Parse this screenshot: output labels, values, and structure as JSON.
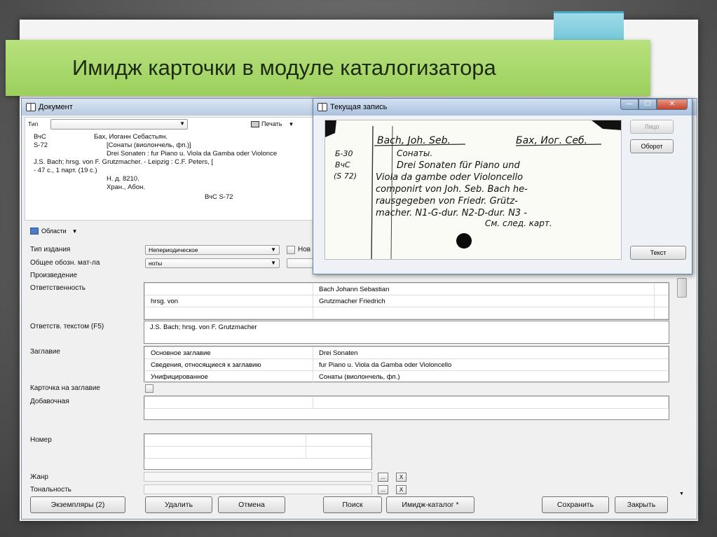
{
  "slide": {
    "title": "Имидж карточки в модуле каталогизатора"
  },
  "doc_window": {
    "title": "Документ",
    "tip_label": "Тип",
    "print_label": "Печать",
    "card_preview": {
      "line1_left": "ВчС",
      "line1_right": "Бах, Иоганн Себастьян.",
      "line2_left": "S-72",
      "line2_right": "[Сонаты (виолончель, фп.)]",
      "line3": "Drei Sonaten : fur Piano u. Viola da Gamba oder Violonce",
      "line4": "J.S. Bach; hrsg. von F. Grutzmacher. - Leipzig : C.F. Peters, [",
      "line5": "- 47 c., 1 парт. (19 с.)",
      "line6": "Н. д. 8210.",
      "line7": "Хран., Абон.",
      "line8": "ВчС S-72"
    },
    "oblasti_label": "Области",
    "fields": {
      "tip_izdaniya": {
        "label": "Тип издания",
        "value": "Непериодическое",
        "new_label": "Нов"
      },
      "obshchee_oboz": {
        "label": "Общее обозн. мат-ла",
        "value": "ноты"
      },
      "proizvedenie": {
        "label": "Произведение"
      },
      "otvetstvennost": {
        "label": "Ответственность",
        "rows": [
          [
            "",
            "Bach Johann Sebastian"
          ],
          [
            "hrsg. von",
            "Grutzmacher Friedrich"
          ],
          [
            "",
            ""
          ]
        ]
      },
      "otvetstv_tekstom": {
        "label": "Ответств. текстом (F5)",
        "value": "J.S. Bach; hrsg. von F. Grutzmacher"
      },
      "zaglavie": {
        "label": "Заглавие",
        "rows": [
          [
            "Основное заглавие",
            "Drei Sonaten"
          ],
          [
            "Сведения, относящиеся к заглавию",
            "fur Piano u. Viola da Gamba oder Violoncello"
          ],
          [
            "Унифицированное",
            "Сонаты (виолончель, фп.)"
          ]
        ]
      },
      "kartochka": {
        "label": "Карточка на заглавие"
      },
      "dobavochnaya": {
        "label": "Добавочная"
      },
      "nomer": {
        "label": "Номер"
      },
      "zhanr": {
        "label": "Жанр"
      },
      "tonalnost": {
        "label": "Тональность"
      }
    },
    "mini_buttons": {
      "ellipsis": "...",
      "clear": "X"
    },
    "buttons": {
      "ekzemplyary": "Экземпляры (2)",
      "udalit": "Удалить",
      "otmena": "Отмена",
      "poisk": "Поиск",
      "imidzh": "Имидж-каталог  *",
      "sokhranit": "Сохранить",
      "zakryt": "Закрыть"
    }
  },
  "record_window": {
    "title": "Текущая запись",
    "buttons": {
      "litso": "Лицо",
      "oborot": "Оборот",
      "tekst": "Текст"
    },
    "card_text": {
      "h_left": "Bach, Joh. Seb.",
      "h_right": "Бах, Иог. Себ.",
      "shelf1": "Б-30",
      "shelf2": "ВчС",
      "shelf3": "(S 72)",
      "t1": "Сонаты.",
      "t2": "Drei Sonaten für Piano und",
      "t3": "Viola da gambe oder Violoncello",
      "t4": "componirt von Joh. Seb. Bach he-",
      "t5": "rausgegeben von Friedr. Grütz-",
      "t6": "macher. N1-G-dur. N2-D-dur. N3 -",
      "t7": "См. след. карт."
    }
  },
  "colors": {
    "title_band": "#a8d86a",
    "accent_cyan": "#7fcde0",
    "window_border": "#5f7ea3"
  }
}
